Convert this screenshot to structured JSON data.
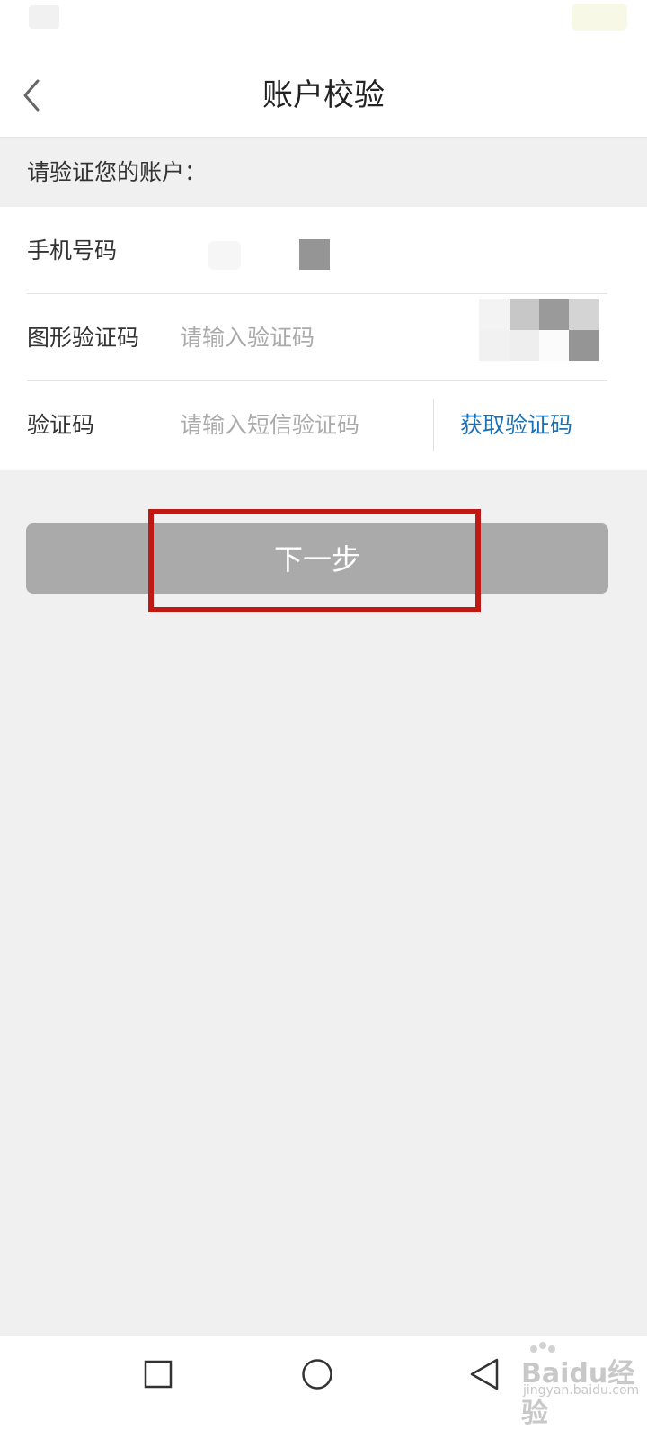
{
  "header": {
    "title": "账户校验",
    "back_icon": "chevron-left-icon"
  },
  "prompt": "请验证您的账户：",
  "form": {
    "phone": {
      "label": "手机号码"
    },
    "captcha": {
      "label": "图形验证码",
      "placeholder": "请输入验证码"
    },
    "sms": {
      "label": "验证码",
      "placeholder": "请输入短信验证码",
      "action_label": "获取验证码"
    }
  },
  "next_button": {
    "label": "下一步"
  },
  "colors": {
    "link": "#1b6fb3",
    "button_disabled": "#aaaaaa",
    "highlight": "#c01815",
    "background": "#f0f0f0"
  },
  "navbar": {
    "icons": [
      "square-recents-icon",
      "circle-home-icon",
      "triangle-back-icon"
    ]
  },
  "watermark": {
    "text": "Baidu经验",
    "sub": "jingyan.baidu.com"
  }
}
